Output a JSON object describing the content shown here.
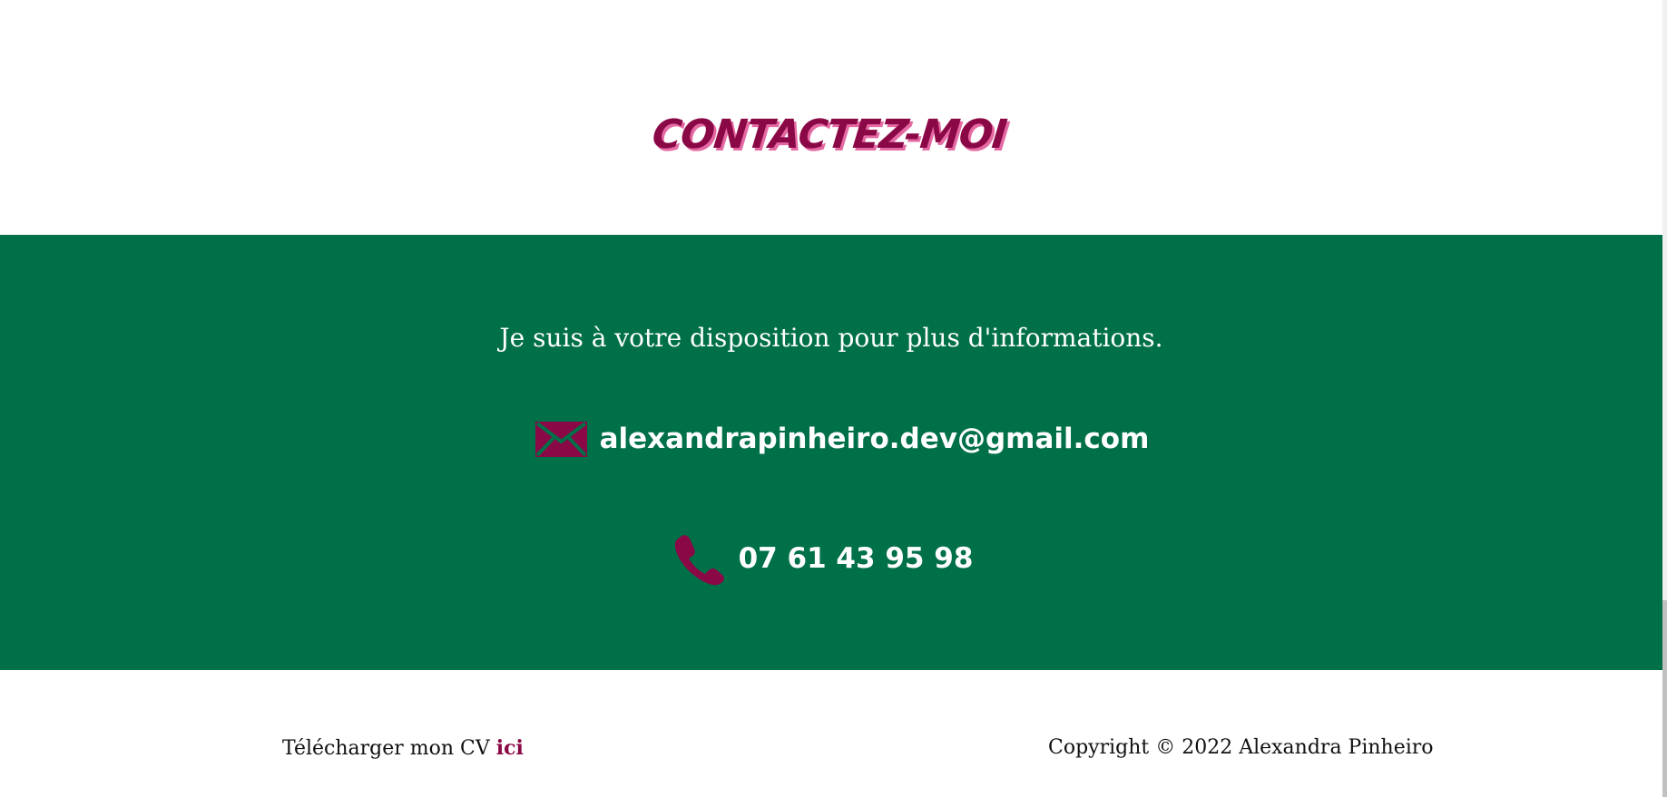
{
  "heading": "CONTACTEZ-MOI",
  "contact": {
    "intro": "Je suis à votre disposition pour plus d'informations.",
    "email": {
      "icon": "envelope-icon",
      "value": "alexandrapinheiro.dev@gmail.com"
    },
    "phone": {
      "icon": "phone-icon",
      "value": "07 61 43 95 98"
    }
  },
  "footer": {
    "cv_prefix": "Télécharger mon CV",
    "cv_link": "ici",
    "copyright": "Copyright © 2022 Alexandra Pinheiro"
  },
  "colors": {
    "green": "#007048",
    "burgundy": "#8a0846",
    "pink_shadow": "#e56aa3",
    "white": "#ffffff"
  }
}
